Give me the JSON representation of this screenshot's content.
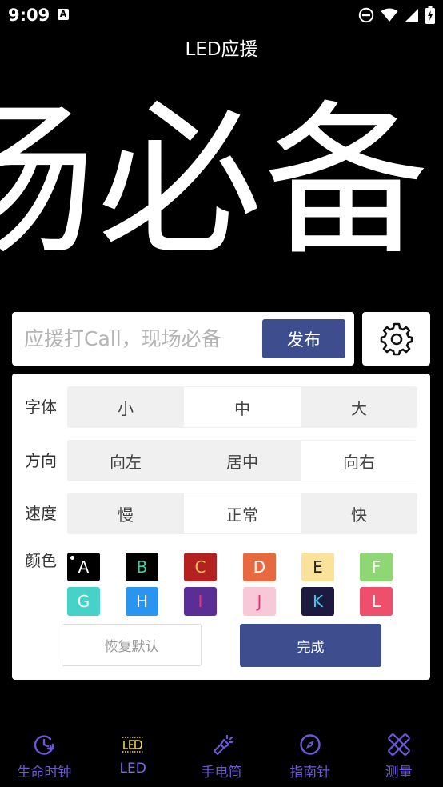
{
  "status_bar": {
    "time": "9:09",
    "notification": "A"
  },
  "app": {
    "title": "LED应援"
  },
  "led": {
    "text": "场必备"
  },
  "input": {
    "placeholder": "应援打Call，现场必备",
    "publish_label": "发布"
  },
  "font_size": {
    "label": "字体",
    "options": [
      "小",
      "中",
      "大"
    ],
    "selected": "中"
  },
  "direction": {
    "label": "方向",
    "options": [
      "向左",
      "居中",
      "向右"
    ],
    "selected": "向右"
  },
  "speed": {
    "label": "速度",
    "options": [
      "慢",
      "正常",
      "快"
    ],
    "selected": "正常"
  },
  "color": {
    "label": "颜色",
    "selected": "A",
    "swatches": [
      {
        "letter": "A",
        "bg": "#000000",
        "fg": "#ffffff"
      },
      {
        "letter": "B",
        "bg": "#000000",
        "fg": "#3fd0a6"
      },
      {
        "letter": "C",
        "bg": "#b42121",
        "fg": "#f7c54b"
      },
      {
        "letter": "D",
        "bg": "#e7693f",
        "fg": "#ffffff"
      },
      {
        "letter": "E",
        "bg": "#fbe29a",
        "fg": "#222222"
      },
      {
        "letter": "F",
        "bg": "#8fd674",
        "fg": "#ffffff"
      },
      {
        "letter": "G",
        "bg": "#46d1c9",
        "fg": "#ffffff"
      },
      {
        "letter": "H",
        "bg": "#2a95f0",
        "fg": "#ffffff"
      },
      {
        "letter": "I",
        "bg": "#5b2e96",
        "fg": "#e6357b"
      },
      {
        "letter": "J",
        "bg": "#f8c8d8",
        "fg": "#e6357b"
      },
      {
        "letter": "K",
        "bg": "#1c1a3e",
        "fg": "#40c8e8"
      },
      {
        "letter": "L",
        "bg": "#ee4f6a",
        "fg": "#ffffff"
      }
    ]
  },
  "actions": {
    "reset_label": "恢复默认",
    "done_label": "完成"
  },
  "nav": {
    "accent": "#6a58d6",
    "items": [
      {
        "label": "生命时钟",
        "icon": "clock-icon"
      },
      {
        "label": "LED",
        "icon": "led-icon"
      },
      {
        "label": "手电筒",
        "icon": "flashlight-icon"
      },
      {
        "label": "指南针",
        "icon": "compass-icon"
      },
      {
        "label": "测量",
        "icon": "ruler-icon"
      }
    ]
  }
}
